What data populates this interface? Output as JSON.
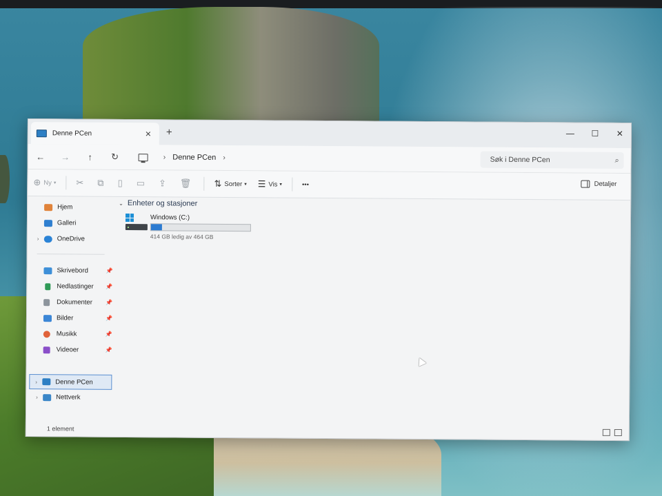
{
  "window": {
    "tab_title": "Denne PCen",
    "new_tab": "+",
    "close_tab": "✕",
    "minimize": "—",
    "maximize": "☐",
    "close": "✕"
  },
  "addressbar": {
    "back_icon": "arrow-left-icon",
    "forward_icon": "arrow-right-icon",
    "up_icon": "arrow-up-icon",
    "refresh_icon": "refresh-icon",
    "path": [
      "Denne PCen"
    ],
    "separator": "›",
    "search_placeholder": "Søk i Denne PCen"
  },
  "commandbar": {
    "new_label": "Ny",
    "sort_label": "Sorter",
    "view_label": "Vis",
    "more_label": "•••",
    "details_label": "Detaljer"
  },
  "sidebar": {
    "top": [
      {
        "label": "Hjem",
        "icon": "home-icon",
        "color": "#e0833a"
      },
      {
        "label": "Galleri",
        "icon": "gallery-icon",
        "color": "#2f7fd0"
      },
      {
        "label": "OneDrive",
        "icon": "cloud-icon",
        "color": "#2b83d6"
      }
    ],
    "quick": [
      {
        "label": "Skrivebord",
        "icon": "desktop-icon",
        "color": "#3d8fd8"
      },
      {
        "label": "Nedlastinger",
        "icon": "download-icon",
        "color": "#2f9a57"
      },
      {
        "label": "Dokumenter",
        "icon": "document-icon",
        "color": "#8c949c"
      },
      {
        "label": "Bilder",
        "icon": "pictures-icon",
        "color": "#3b86d6"
      },
      {
        "label": "Musikk",
        "icon": "music-icon",
        "color": "#e0623a"
      },
      {
        "label": "Videoer",
        "icon": "video-icon",
        "color": "#8a4fc9"
      }
    ],
    "bottom": [
      {
        "label": "Denne PCen",
        "icon": "pc-icon",
        "color": "#2d7fc4"
      },
      {
        "label": "Nettverk",
        "icon": "network-icon",
        "color": "#3a86c8"
      }
    ],
    "pin": "📌"
  },
  "content": {
    "group_header": "Enheter og stasjoner",
    "drive": {
      "name": "Windows (C:)",
      "free_text": "414 GB ledig av 464 GB",
      "used_fraction": 0.108
    }
  },
  "statusbar": {
    "count": "1 element"
  }
}
